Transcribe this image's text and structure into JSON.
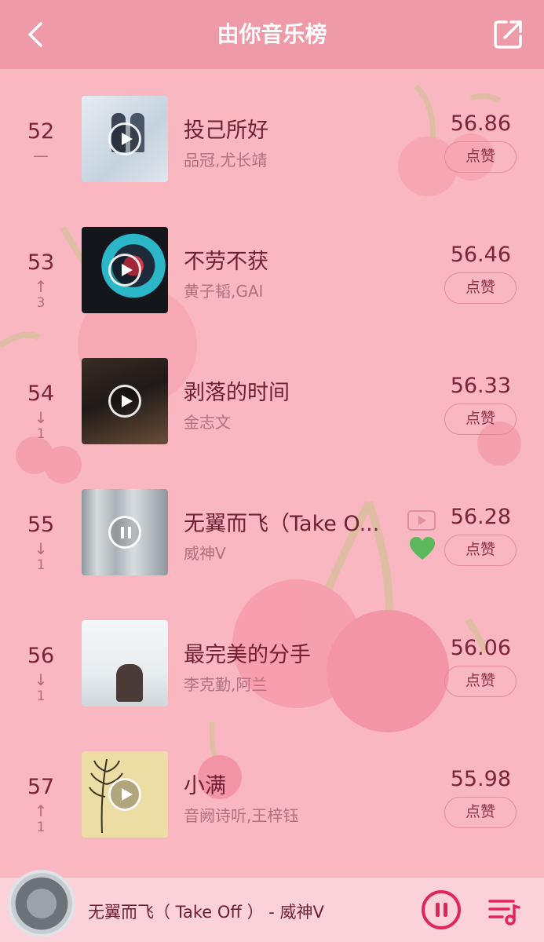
{
  "header": {
    "title": "由你音乐榜",
    "back_icon": "chevron-left-icon",
    "share_icon": "share-external-icon"
  },
  "songs": [
    {
      "rank": "52",
      "trend": "—",
      "trend_dir": "flat",
      "change": "",
      "title": "投己所好",
      "artist": "品冠,尤长靖",
      "score": "56.86",
      "like_label": "点赞",
      "cover_colors": [
        "#dfe6ee",
        "#b9c8d8"
      ],
      "cover_icon": "play-icon"
    },
    {
      "rank": "53",
      "trend": "↑",
      "trend_dir": "up",
      "change": "3",
      "title": "不劳不获",
      "artist": "黄子韬,GAI",
      "score": "56.46",
      "like_label": "点赞",
      "cover_colors": [
        "#1b1d25",
        "#27b5c9"
      ],
      "cover_icon": "play-icon"
    },
    {
      "rank": "54",
      "trend": "↓",
      "trend_dir": "down",
      "change": "1",
      "title": "剥落的时间",
      "artist": "金志文",
      "score": "56.33",
      "like_label": "点赞",
      "cover_colors": [
        "#2b2320",
        "#6b4e3c"
      ],
      "cover_icon": "play-icon"
    },
    {
      "rank": "55",
      "trend": "↓",
      "trend_dir": "down",
      "change": "1",
      "title": "无翼而飞（Take O...",
      "artist": "威神V",
      "score": "56.28",
      "like_label": "点赞",
      "cover_colors": [
        "#9ea5ab",
        "#cfd4d8"
      ],
      "cover_icon": "pause-icon",
      "has_mv": true,
      "liked": true
    },
    {
      "rank": "56",
      "trend": "↓",
      "trend_dir": "down",
      "change": "1",
      "title": "最完美的分手",
      "artist": "李克勤,阿兰",
      "score": "56.06",
      "like_label": "点赞",
      "cover_colors": [
        "#eef2f4",
        "#c9d2d8"
      ],
      "cover_icon": "none"
    },
    {
      "rank": "57",
      "trend": "↑",
      "trend_dir": "up",
      "change": "1",
      "title": "小满",
      "artist": "音阙诗听,王梓钰",
      "score": "55.98",
      "like_label": "点赞",
      "cover_colors": [
        "#efe0a8",
        "#e4cf86"
      ],
      "cover_icon": "play-icon"
    }
  ],
  "player": {
    "now_playing": "无翼而飞（ Take Off ） - 威神V",
    "pause_icon": "pause-circle-icon",
    "playlist_icon": "playlist-icon"
  },
  "colors": {
    "background": "#f9b7c2",
    "header": "#ee9aa8",
    "accent": "#e0245e",
    "heart": "#5cb85c"
  }
}
